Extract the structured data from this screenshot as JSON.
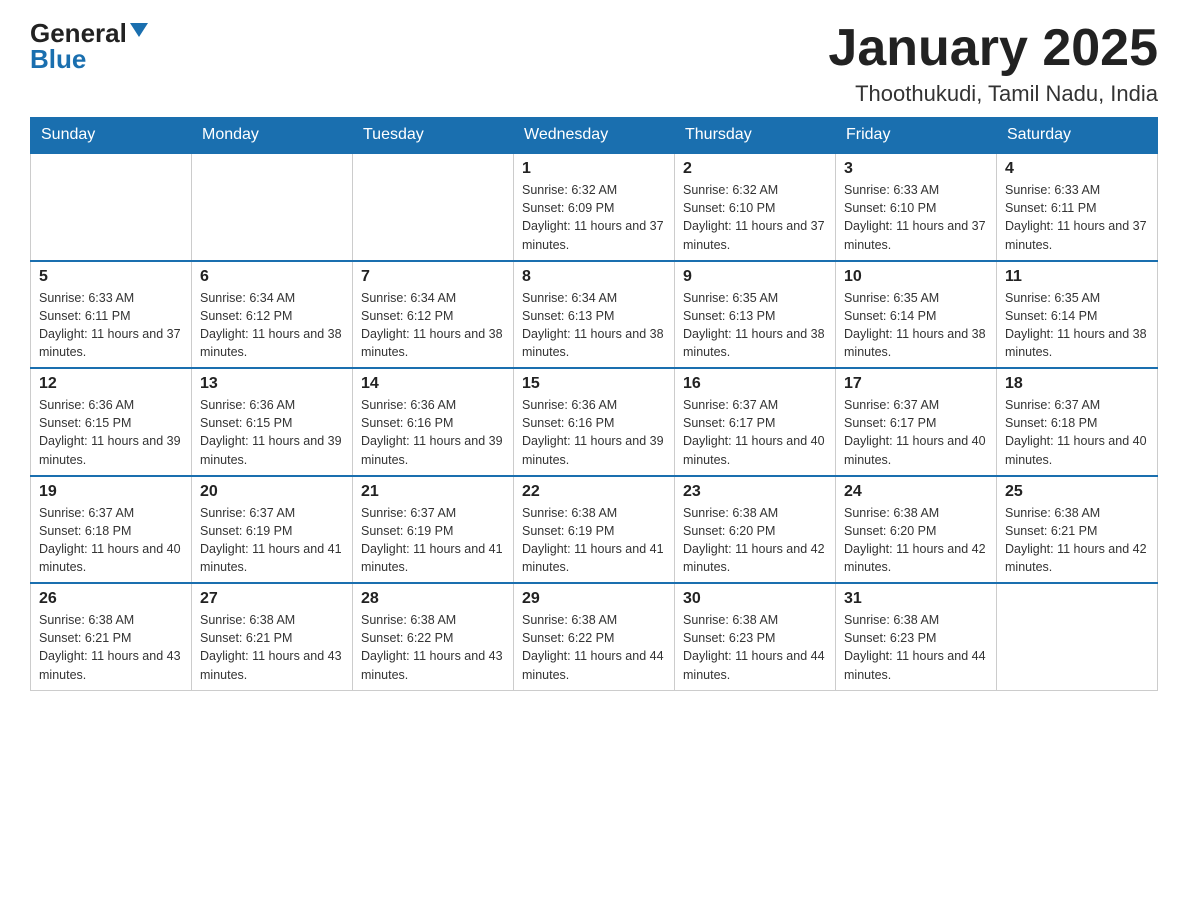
{
  "logo": {
    "general": "General",
    "blue": "Blue"
  },
  "title": "January 2025",
  "subtitle": "Thoothukudi, Tamil Nadu, India",
  "days_of_week": [
    "Sunday",
    "Monday",
    "Tuesday",
    "Wednesday",
    "Thursday",
    "Friday",
    "Saturday"
  ],
  "weeks": [
    [
      {
        "day": "",
        "info": ""
      },
      {
        "day": "",
        "info": ""
      },
      {
        "day": "",
        "info": ""
      },
      {
        "day": "1",
        "info": "Sunrise: 6:32 AM\nSunset: 6:09 PM\nDaylight: 11 hours and 37 minutes."
      },
      {
        "day": "2",
        "info": "Sunrise: 6:32 AM\nSunset: 6:10 PM\nDaylight: 11 hours and 37 minutes."
      },
      {
        "day": "3",
        "info": "Sunrise: 6:33 AM\nSunset: 6:10 PM\nDaylight: 11 hours and 37 minutes."
      },
      {
        "day": "4",
        "info": "Sunrise: 6:33 AM\nSunset: 6:11 PM\nDaylight: 11 hours and 37 minutes."
      }
    ],
    [
      {
        "day": "5",
        "info": "Sunrise: 6:33 AM\nSunset: 6:11 PM\nDaylight: 11 hours and 37 minutes."
      },
      {
        "day": "6",
        "info": "Sunrise: 6:34 AM\nSunset: 6:12 PM\nDaylight: 11 hours and 38 minutes."
      },
      {
        "day": "7",
        "info": "Sunrise: 6:34 AM\nSunset: 6:12 PM\nDaylight: 11 hours and 38 minutes."
      },
      {
        "day": "8",
        "info": "Sunrise: 6:34 AM\nSunset: 6:13 PM\nDaylight: 11 hours and 38 minutes."
      },
      {
        "day": "9",
        "info": "Sunrise: 6:35 AM\nSunset: 6:13 PM\nDaylight: 11 hours and 38 minutes."
      },
      {
        "day": "10",
        "info": "Sunrise: 6:35 AM\nSunset: 6:14 PM\nDaylight: 11 hours and 38 minutes."
      },
      {
        "day": "11",
        "info": "Sunrise: 6:35 AM\nSunset: 6:14 PM\nDaylight: 11 hours and 38 minutes."
      }
    ],
    [
      {
        "day": "12",
        "info": "Sunrise: 6:36 AM\nSunset: 6:15 PM\nDaylight: 11 hours and 39 minutes."
      },
      {
        "day": "13",
        "info": "Sunrise: 6:36 AM\nSunset: 6:15 PM\nDaylight: 11 hours and 39 minutes."
      },
      {
        "day": "14",
        "info": "Sunrise: 6:36 AM\nSunset: 6:16 PM\nDaylight: 11 hours and 39 minutes."
      },
      {
        "day": "15",
        "info": "Sunrise: 6:36 AM\nSunset: 6:16 PM\nDaylight: 11 hours and 39 minutes."
      },
      {
        "day": "16",
        "info": "Sunrise: 6:37 AM\nSunset: 6:17 PM\nDaylight: 11 hours and 40 minutes."
      },
      {
        "day": "17",
        "info": "Sunrise: 6:37 AM\nSunset: 6:17 PM\nDaylight: 11 hours and 40 minutes."
      },
      {
        "day": "18",
        "info": "Sunrise: 6:37 AM\nSunset: 6:18 PM\nDaylight: 11 hours and 40 minutes."
      }
    ],
    [
      {
        "day": "19",
        "info": "Sunrise: 6:37 AM\nSunset: 6:18 PM\nDaylight: 11 hours and 40 minutes."
      },
      {
        "day": "20",
        "info": "Sunrise: 6:37 AM\nSunset: 6:19 PM\nDaylight: 11 hours and 41 minutes."
      },
      {
        "day": "21",
        "info": "Sunrise: 6:37 AM\nSunset: 6:19 PM\nDaylight: 11 hours and 41 minutes."
      },
      {
        "day": "22",
        "info": "Sunrise: 6:38 AM\nSunset: 6:19 PM\nDaylight: 11 hours and 41 minutes."
      },
      {
        "day": "23",
        "info": "Sunrise: 6:38 AM\nSunset: 6:20 PM\nDaylight: 11 hours and 42 minutes."
      },
      {
        "day": "24",
        "info": "Sunrise: 6:38 AM\nSunset: 6:20 PM\nDaylight: 11 hours and 42 minutes."
      },
      {
        "day": "25",
        "info": "Sunrise: 6:38 AM\nSunset: 6:21 PM\nDaylight: 11 hours and 42 minutes."
      }
    ],
    [
      {
        "day": "26",
        "info": "Sunrise: 6:38 AM\nSunset: 6:21 PM\nDaylight: 11 hours and 43 minutes."
      },
      {
        "day": "27",
        "info": "Sunrise: 6:38 AM\nSunset: 6:21 PM\nDaylight: 11 hours and 43 minutes."
      },
      {
        "day": "28",
        "info": "Sunrise: 6:38 AM\nSunset: 6:22 PM\nDaylight: 11 hours and 43 minutes."
      },
      {
        "day": "29",
        "info": "Sunrise: 6:38 AM\nSunset: 6:22 PM\nDaylight: 11 hours and 44 minutes."
      },
      {
        "day": "30",
        "info": "Sunrise: 6:38 AM\nSunset: 6:23 PM\nDaylight: 11 hours and 44 minutes."
      },
      {
        "day": "31",
        "info": "Sunrise: 6:38 AM\nSunset: 6:23 PM\nDaylight: 11 hours and 44 minutes."
      },
      {
        "day": "",
        "info": ""
      }
    ]
  ]
}
